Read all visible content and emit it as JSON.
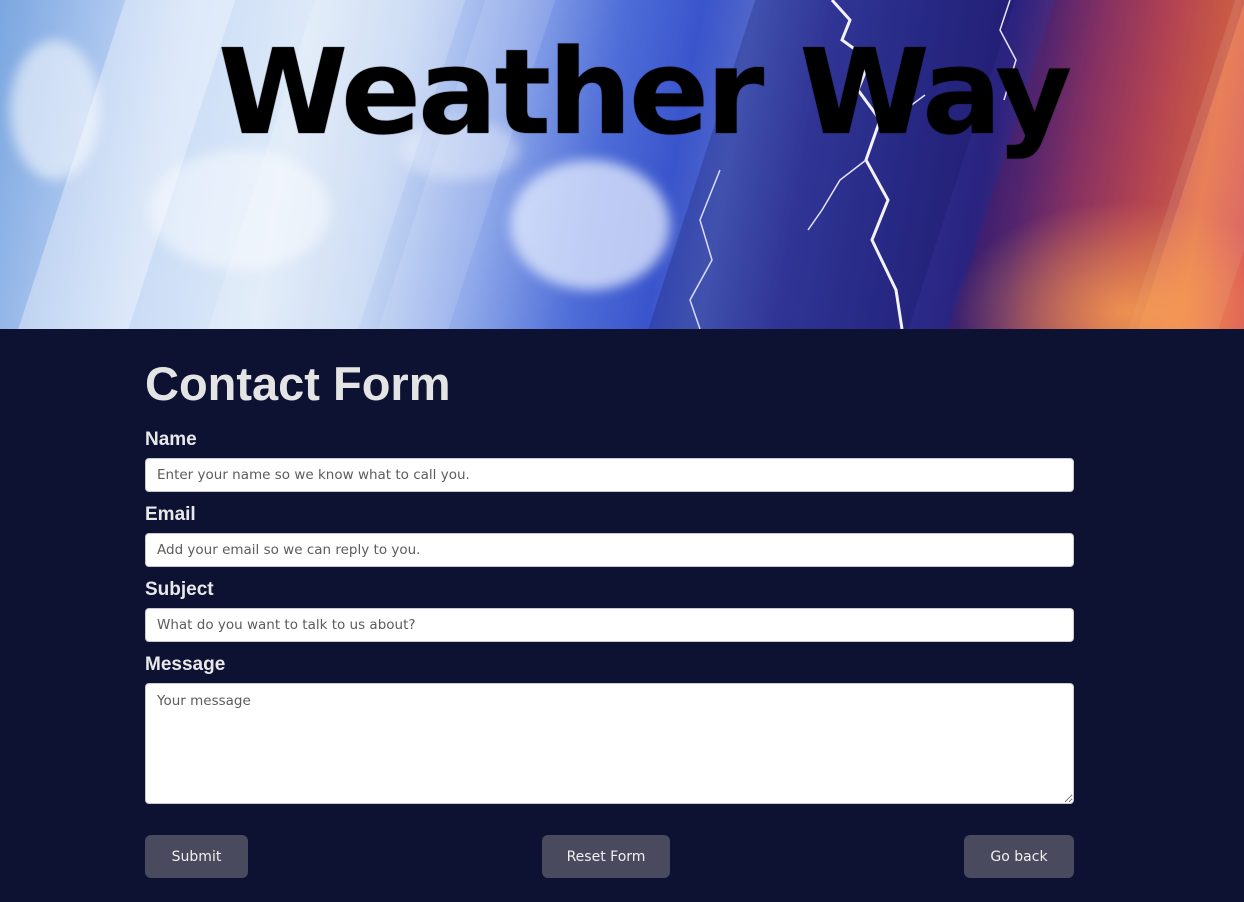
{
  "banner": {
    "title": "Weather Way"
  },
  "form": {
    "title": "Contact Form",
    "fields": [
      {
        "label": "Name",
        "placeholder": "Enter your name so we know what to call you.",
        "value": ""
      },
      {
        "label": "Email",
        "placeholder": "Add your email so we can reply to you.",
        "value": ""
      },
      {
        "label": "Subject",
        "placeholder": "What do you want to talk to us about?",
        "value": ""
      },
      {
        "label": "Message",
        "placeholder": "Your message",
        "value": ""
      }
    ],
    "buttons": {
      "submit": "Submit",
      "reset": "Reset Form",
      "back": "Go back"
    }
  },
  "colors": {
    "page_background": "#0d1233",
    "button_background": "#4a4a5e",
    "label_text": "#e8e8e8",
    "title_text": "#000000"
  }
}
